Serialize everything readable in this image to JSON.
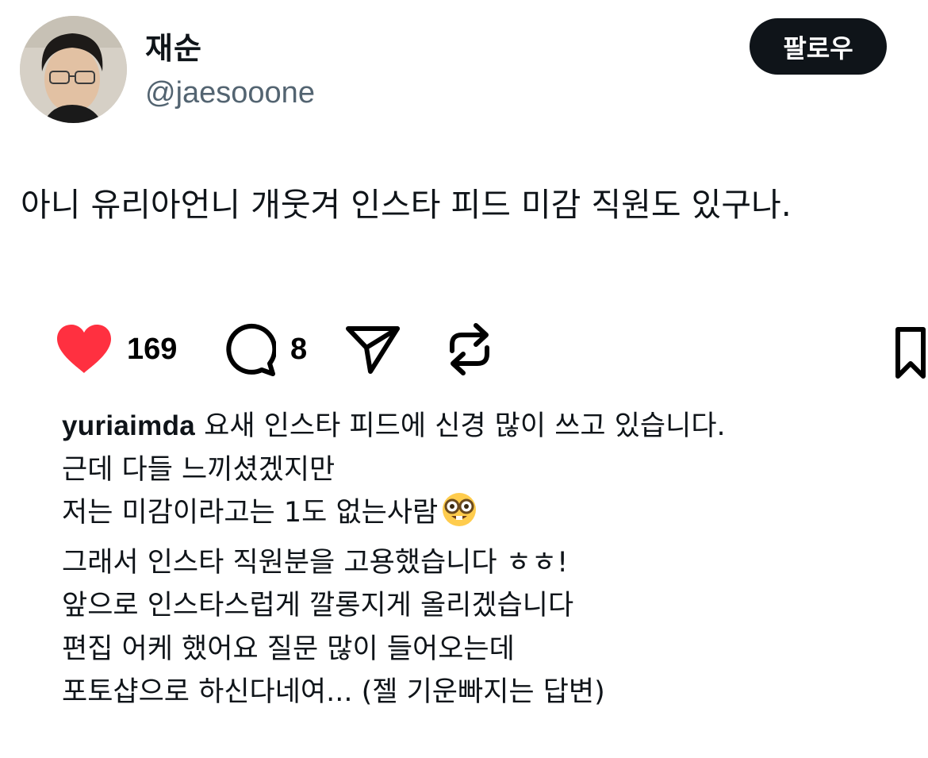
{
  "author": {
    "name": "재순",
    "handle": "@jaesooone"
  },
  "follow_button": {
    "label": "팔로우"
  },
  "tweet": {
    "text": "아니 유리아언니 개웃겨 인스타 피드 미감 직원도 있구나."
  },
  "embedded_post": {
    "actions": {
      "likes": "169",
      "comments": "8"
    },
    "caption": {
      "username": "yuriaimda",
      "first_line_text": " 요새 인스타 피드에 신경 많이 쓰고 있습니다.",
      "line2": "근데 다들 느끼셨겠지만",
      "line3": "저는 미감이라고는 1도 없는사람",
      "line4": "그래서 인스타 직원분을 고용했습니다 ㅎㅎ!",
      "line5": "앞으로 인스타스럽게 깔롱지게 올리겠습니다",
      "line6": "편집 어케 했어요 질문 많이 들어오는데",
      "line7": "포토샵으로 하신다네여... (젤 기운빠지는 답변)"
    }
  },
  "icons": {
    "like": "heart-icon",
    "comment": "comment-bubble-icon",
    "share": "paper-plane-icon",
    "repost": "repost-arrows-icon",
    "bookmark": "bookmark-icon",
    "emoji": "nerd-face-emoji-icon"
  },
  "colors": {
    "like_red": "#ff3040",
    "follow_button_bg": "#0f1419",
    "handle_gray": "#536471"
  }
}
